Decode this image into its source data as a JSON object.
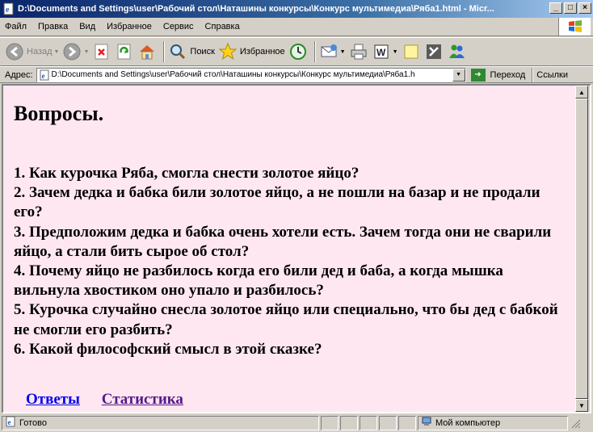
{
  "window": {
    "title": "D:\\Documents and Settings\\user\\Рабочий стол\\Наташины конкурсы\\Конкурс мультимедиа\\Ряба1.html - Micr...",
    "buttons": {
      "minimize": "_",
      "maximize": "□",
      "close": "×"
    }
  },
  "menu": {
    "items": [
      "Файл",
      "Правка",
      "Вид",
      "Избранное",
      "Сервис",
      "Справка"
    ]
  },
  "toolbar": {
    "back_label": "Назад",
    "search_label": "Поиск",
    "favorites_label": "Избранное"
  },
  "address": {
    "label": "Адрес:",
    "value": "D:\\Documents and Settings\\user\\Рабочий стол\\Наташины конкурсы\\Конкурс мультимедиа\\Ряба1.h",
    "go_label": "Переход",
    "links_label": "Ссылки"
  },
  "page": {
    "heading": "Вопросы.",
    "questions": [
      "1. Как курочка Ряба, смогла снести золотое яйцо?",
      "2. Зачем дедка и бабка били золотое яйцо, а не пошли на базар и не продали его?",
      "3. Предположим дедка и бабка очень хотели есть. Зачем тогда они не сварили яйцо, а стали бить сырое об стол?",
      "4. Почему яйцо не разбилось когда его били дед и баба, а когда мышка вильнула хвостиком оно упало и разбилось?",
      "5. Курочка случайно снесла золотое яйцо или специально, что бы дед с бабкой не смогли его разбить?",
      "6. Какой философский смысл в этой сказке?"
    ],
    "links": {
      "answers": "Ответы",
      "statistics": "Статистика"
    }
  },
  "status": {
    "text": "Готово",
    "zone": "Мой компьютер"
  },
  "colors": {
    "page_background": "#ffe7f1",
    "link": "#0000ee",
    "visited_link": "#551a8b",
    "titlebar_start": "#0a246a"
  }
}
